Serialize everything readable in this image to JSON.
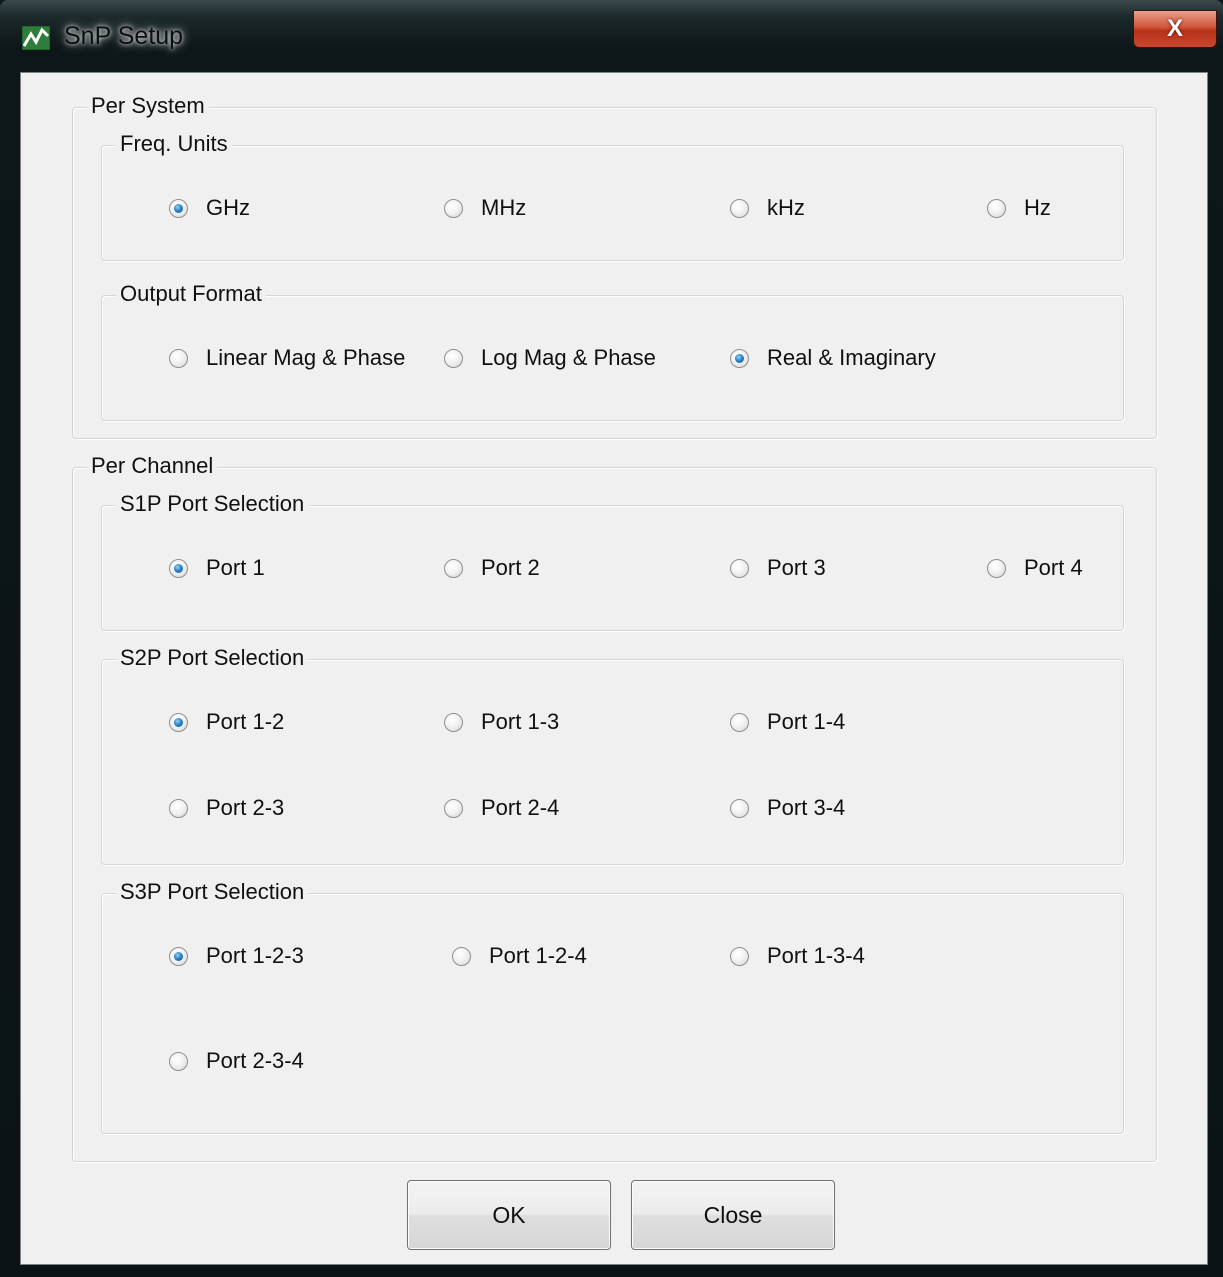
{
  "window": {
    "title": "SnP Setup",
    "close_glyph": "X"
  },
  "per_system": {
    "legend": "Per System",
    "freq_units": {
      "legend": "Freq. Units",
      "options": [
        "GHz",
        "MHz",
        "kHz",
        "Hz"
      ],
      "selected": "GHz"
    },
    "output_format": {
      "legend": "Output Format",
      "options": [
        "Linear Mag & Phase",
        "Log Mag & Phase",
        "Real & Imaginary"
      ],
      "selected": "Real & Imaginary"
    }
  },
  "per_channel": {
    "legend": "Per Channel",
    "s1p": {
      "legend": "S1P Port Selection",
      "options": [
        "Port 1",
        "Port 2",
        "Port 3",
        "Port 4"
      ],
      "selected": "Port 1"
    },
    "s2p": {
      "legend": "S2P Port Selection",
      "options": [
        "Port 1-2",
        "Port 1-3",
        "Port 1-4",
        "Port 2-3",
        "Port 2-4",
        "Port 3-4"
      ],
      "selected": "Port 1-2"
    },
    "s3p": {
      "legend": "S3P Port Selection",
      "options": [
        "Port 1-2-3",
        "Port 1-2-4",
        "Port 1-3-4",
        "Port 2-3-4"
      ],
      "selected": "Port 1-2-3"
    }
  },
  "buttons": {
    "ok": "OK",
    "close": "Close"
  },
  "icons": {
    "app": "signal-graph-icon",
    "close": "close-icon"
  },
  "colors": {
    "dialog_bg": "#f0f0f0",
    "radio_selected": "#2a86c8",
    "close_button": "#c8482c"
  }
}
